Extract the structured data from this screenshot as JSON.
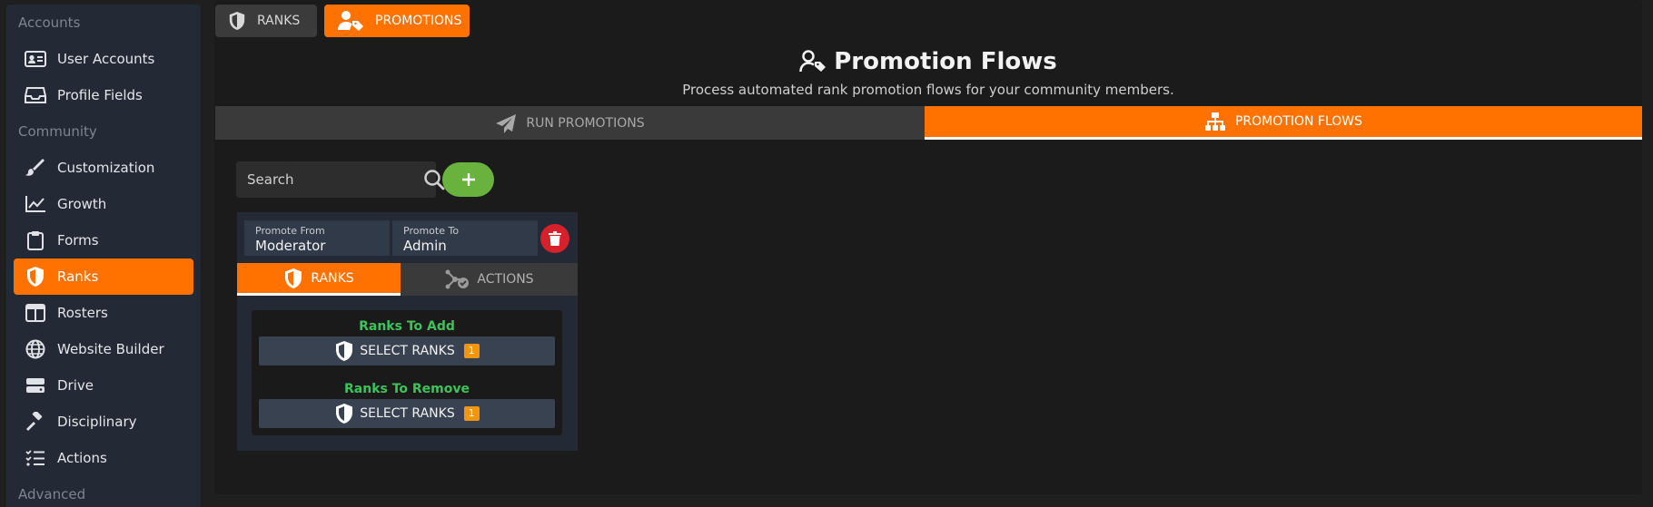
{
  "sidebar": {
    "sections": [
      "Accounts",
      "Community",
      "Advanced"
    ],
    "items": [
      {
        "label": "User Accounts",
        "icon": "id-card-icon"
      },
      {
        "label": "Profile Fields",
        "icon": "inbox-tray-icon"
      },
      {
        "label": "Customization",
        "icon": "paintbrush-icon"
      },
      {
        "label": "Growth",
        "icon": "line-chart-icon"
      },
      {
        "label": "Forms",
        "icon": "clipboard-icon"
      },
      {
        "label": "Ranks",
        "icon": "shield-icon",
        "active": true
      },
      {
        "label": "Rosters",
        "icon": "columns-icon"
      },
      {
        "label": "Website Builder",
        "icon": "globe-icon"
      },
      {
        "label": "Drive",
        "icon": "hard-drive-icon"
      },
      {
        "label": "Disciplinary",
        "icon": "gavel-icon"
      },
      {
        "label": "Actions",
        "icon": "checklist-icon"
      }
    ]
  },
  "top_tabs": [
    {
      "label": "RANKS",
      "icon": "shield-icon"
    },
    {
      "label": "PROMOTIONS",
      "icon": "user-tag-icon",
      "active": true
    }
  ],
  "header": {
    "title": "Promotion Flows",
    "subtitle": "Process automated rank promotion flows for your community members."
  },
  "section_tabs": [
    {
      "label": "RUN PROMOTIONS",
      "icon": "paper-plane-icon"
    },
    {
      "label": "PROMOTION FLOWS",
      "icon": "sitemap-icon",
      "active": true
    }
  ],
  "search": {
    "placeholder": "Search",
    "value": ""
  },
  "flow": {
    "from_label": "Promote From",
    "from_value": "Moderator",
    "to_label": "Promote To",
    "to_value": "Admin",
    "tabs": [
      {
        "label": "RANKS",
        "active": true
      },
      {
        "label": "ACTIONS"
      }
    ],
    "ranks_to_add": {
      "label": "Ranks To Add",
      "button": "SELECT RANKS",
      "count": "1"
    },
    "ranks_to_remove": {
      "label": "Ranks To Remove",
      "button": "SELECT RANKS",
      "count": "1"
    }
  },
  "colors": {
    "accent": "#ff7200",
    "sidebar_bg": "#232a36",
    "add_green": "#6ab23e",
    "delete_red": "#d6202c",
    "rank_label_green": "#3ec35b",
    "badge": "#f2960c"
  }
}
